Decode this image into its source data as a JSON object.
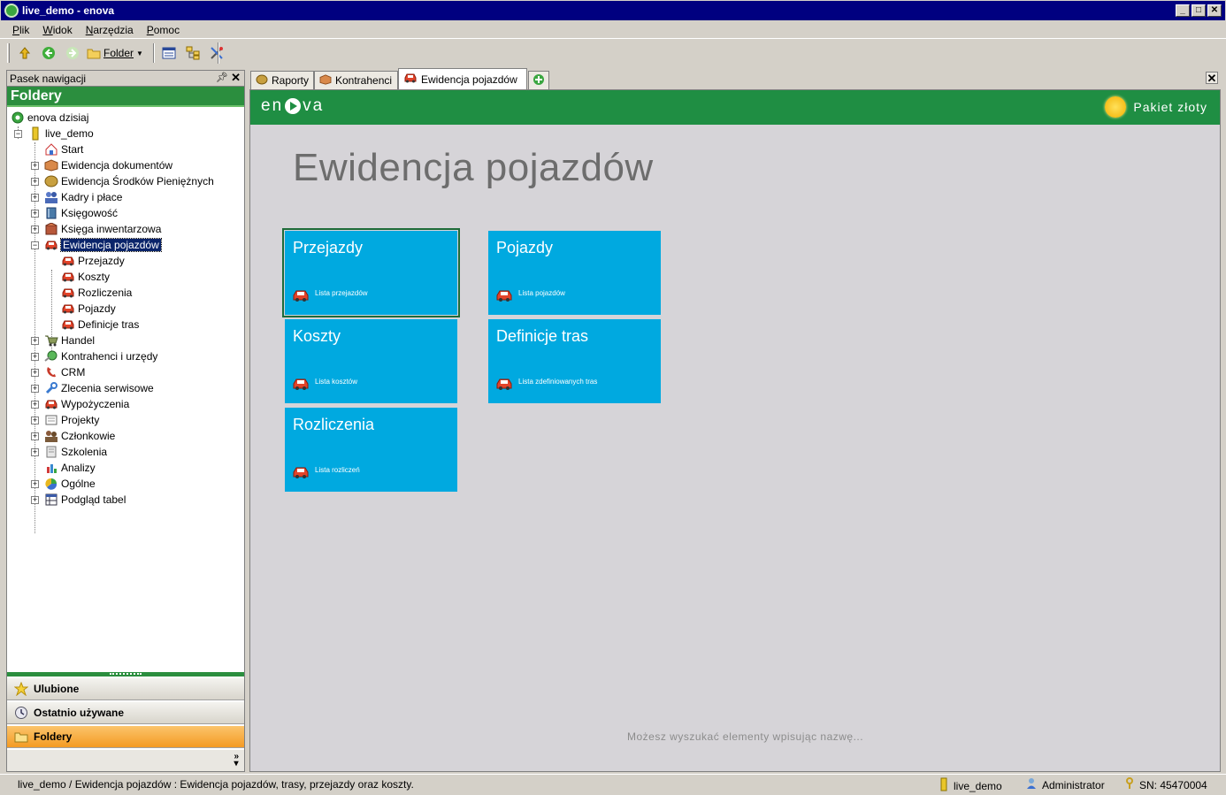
{
  "window": {
    "title": "live_demo - enova"
  },
  "menu": [
    {
      "label": "Plik",
      "u": "P",
      "rest": "lik"
    },
    {
      "label": "Widok",
      "u": "W",
      "rest": "idok"
    },
    {
      "label": "Narzędzia",
      "u": "N",
      "rest": "arzędzia"
    },
    {
      "label": "Pomoc",
      "u": "P",
      "rest": "omoc"
    }
  ],
  "toolbar": {
    "folder_label": "Folder"
  },
  "nav": {
    "header": "Pasek nawigacji",
    "title": "Foldery",
    "root": "enova dzisiaj",
    "db": "live_demo",
    "items": [
      {
        "label": "Start",
        "icon": "home-icon",
        "expandable": false
      },
      {
        "label": "Ewidencja dokumentów",
        "icon": "box-icon",
        "expandable": true
      },
      {
        "label": "Ewidencja Środków Pieniężnych",
        "icon": "coins-icon",
        "expandable": true
      },
      {
        "label": "Kadry i płace",
        "icon": "people-icon",
        "expandable": true
      },
      {
        "label": "Księgowość",
        "icon": "book-icon",
        "expandable": true
      },
      {
        "label": "Księga inwentarzowa",
        "icon": "crate-icon",
        "expandable": true
      },
      {
        "label": "Ewidencja pojazdów",
        "icon": "car-icon",
        "expandable": true,
        "expanded": true,
        "selected": true,
        "children": [
          "Przejazdy",
          "Koszty",
          "Rozliczenia",
          "Pojazdy",
          "Definicje tras"
        ]
      },
      {
        "label": "Handel",
        "icon": "cart-icon",
        "expandable": true
      },
      {
        "label": "Kontrahenci i urzędy",
        "icon": "globe-icon",
        "expandable": true
      },
      {
        "label": "CRM",
        "icon": "phone-icon",
        "expandable": true
      },
      {
        "label": "Zlecenia serwisowe",
        "icon": "wrench-icon",
        "expandable": true
      },
      {
        "label": "Wypożyczenia",
        "icon": "car-icon",
        "expandable": true
      },
      {
        "label": "Projekty",
        "icon": "folder-icon",
        "expandable": true
      },
      {
        "label": "Członkowie",
        "icon": "people-icon",
        "expandable": true
      },
      {
        "label": "Szkolenia",
        "icon": "document-icon",
        "expandable": true
      },
      {
        "label": "Analizy",
        "icon": "chart-icon",
        "expandable": false
      },
      {
        "label": "Ogólne",
        "icon": "pie-icon",
        "expandable": true
      },
      {
        "label": "Podgląd tabel",
        "icon": "table-icon",
        "expandable": true
      }
    ],
    "buttons": [
      {
        "label": "Ulubione",
        "icon": "star-icon"
      },
      {
        "label": "Ostatnio używane",
        "icon": "clock-icon"
      },
      {
        "label": "Foldery",
        "icon": "folder-icon"
      }
    ]
  },
  "tabs": [
    {
      "label": "Raporty",
      "icon": "coins-icon"
    },
    {
      "label": "Kontrahenci",
      "icon": "box-icon"
    },
    {
      "label": "Ewidencja pojazdów",
      "icon": "car-icon",
      "active": true
    }
  ],
  "brand": {
    "logo_left": "en",
    "logo_right": "va",
    "package": "Pakiet złoty"
  },
  "page": {
    "title": "Ewidencja pojazdów",
    "tiles": [
      {
        "title": "Przejazdy",
        "subtitle": "Lista przejazdów",
        "focused": true
      },
      {
        "title": "Pojazdy",
        "subtitle": "Lista pojazdów"
      },
      {
        "title": "Koszty",
        "subtitle": "Lista kosztów"
      },
      {
        "title": "Definicje tras",
        "subtitle": "Lista zdefiniowanych tras"
      },
      {
        "title": "Rozliczenia",
        "subtitle": "Lista rozliczeń"
      }
    ],
    "search_hint": "Możesz wyszukać elementy wpisując nazwę..."
  },
  "status": {
    "main": "live_demo / Ewidencja pojazdów : Ewidencja pojazdów, trasy, przejazdy oraz koszty.",
    "db": "live_demo",
    "user": "Administrator",
    "sn": "SN: 45470004"
  },
  "colors": {
    "brand_green": "#1f8e43",
    "tile_blue": "#00a9e0",
    "selection": "#0a246a"
  }
}
